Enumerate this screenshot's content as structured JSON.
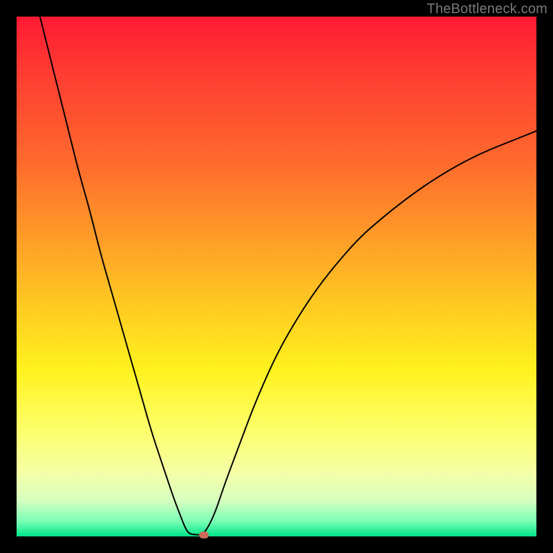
{
  "watermark": "TheBottleneck.com",
  "colors": {
    "frame": "#000000",
    "curve": "#000000",
    "marker": "#cc6b5a",
    "gradient_stops": [
      {
        "pos": 0.0,
        "hex": "#ff1a33"
      },
      {
        "pos": 0.1,
        "hex": "#ff3a32"
      },
      {
        "pos": 0.28,
        "hex": "#ff6a2d"
      },
      {
        "pos": 0.42,
        "hex": "#ff9a28"
      },
      {
        "pos": 0.55,
        "hex": "#ffc822"
      },
      {
        "pos": 0.68,
        "hex": "#fff21e"
      },
      {
        "pos": 0.8,
        "hex": "#fdff6d"
      },
      {
        "pos": 0.88,
        "hex": "#f3ffa8"
      },
      {
        "pos": 0.93,
        "hex": "#d8ffbf"
      },
      {
        "pos": 0.97,
        "hex": "#7dffb5"
      },
      {
        "pos": 1.0,
        "hex": "#00e48a"
      }
    ]
  },
  "chart_data": {
    "type": "line",
    "title": "",
    "xlabel": "",
    "ylabel": "",
    "x_range": [
      0,
      100
    ],
    "y_range": [
      0,
      100
    ],
    "note": "x and y are normalized to % of plot area width/height; y=100 is top of gradient, y=0 is bottom (green).",
    "series": [
      {
        "name": "left-branch",
        "x": [
          4.5,
          6,
          8,
          10,
          12,
          14,
          16,
          18,
          20,
          22,
          24,
          26,
          28,
          30,
          31.5,
          32.5,
          33.2
        ],
        "y": [
          100,
          94,
          86,
          78,
          70,
          63,
          55,
          48,
          41,
          34,
          27,
          20,
          14,
          8,
          4,
          1.5,
          0.5
        ]
      },
      {
        "name": "valley-flat",
        "x": [
          33.2,
          34.5,
          36
        ],
        "y": [
          0.5,
          0.3,
          0.3
        ]
      },
      {
        "name": "right-branch",
        "x": [
          36,
          38,
          40,
          43,
          46,
          50,
          54,
          58,
          62,
          66,
          70,
          75,
          80,
          85,
          90,
          95,
          100
        ],
        "y": [
          0.3,
          4,
          10,
          18,
          26,
          35,
          42,
          48,
          53,
          57.5,
          61,
          65,
          68.5,
          71.5,
          74,
          76,
          78
        ]
      }
    ],
    "marker": {
      "name": "optimum-marker",
      "x": 36,
      "y": 0.3
    }
  }
}
